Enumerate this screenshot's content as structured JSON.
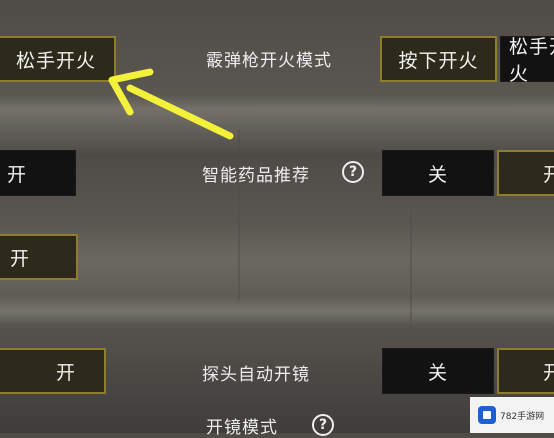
{
  "settings": {
    "shotgun_fire_mode": {
      "label": "霰弹枪开火模式",
      "option_press": "按下开火",
      "option_release": "松手开火",
      "left_release": "松手开火"
    },
    "smart_medicine": {
      "label": "智能药品推荐",
      "help": "?",
      "off": "关",
      "on": "开",
      "left_on": "开"
    },
    "row3": {
      "left_on": "开"
    },
    "peek_auto_scope": {
      "label": "探头自动开镜",
      "off": "关",
      "on": "开",
      "left_on": "开"
    },
    "scope_mode": {
      "label": "开镜模式",
      "help": "?"
    }
  },
  "annotation": {
    "arrow_color": "#f3f13a"
  },
  "watermark": {
    "text": "782手游网",
    "icon": "logo-icon"
  }
}
